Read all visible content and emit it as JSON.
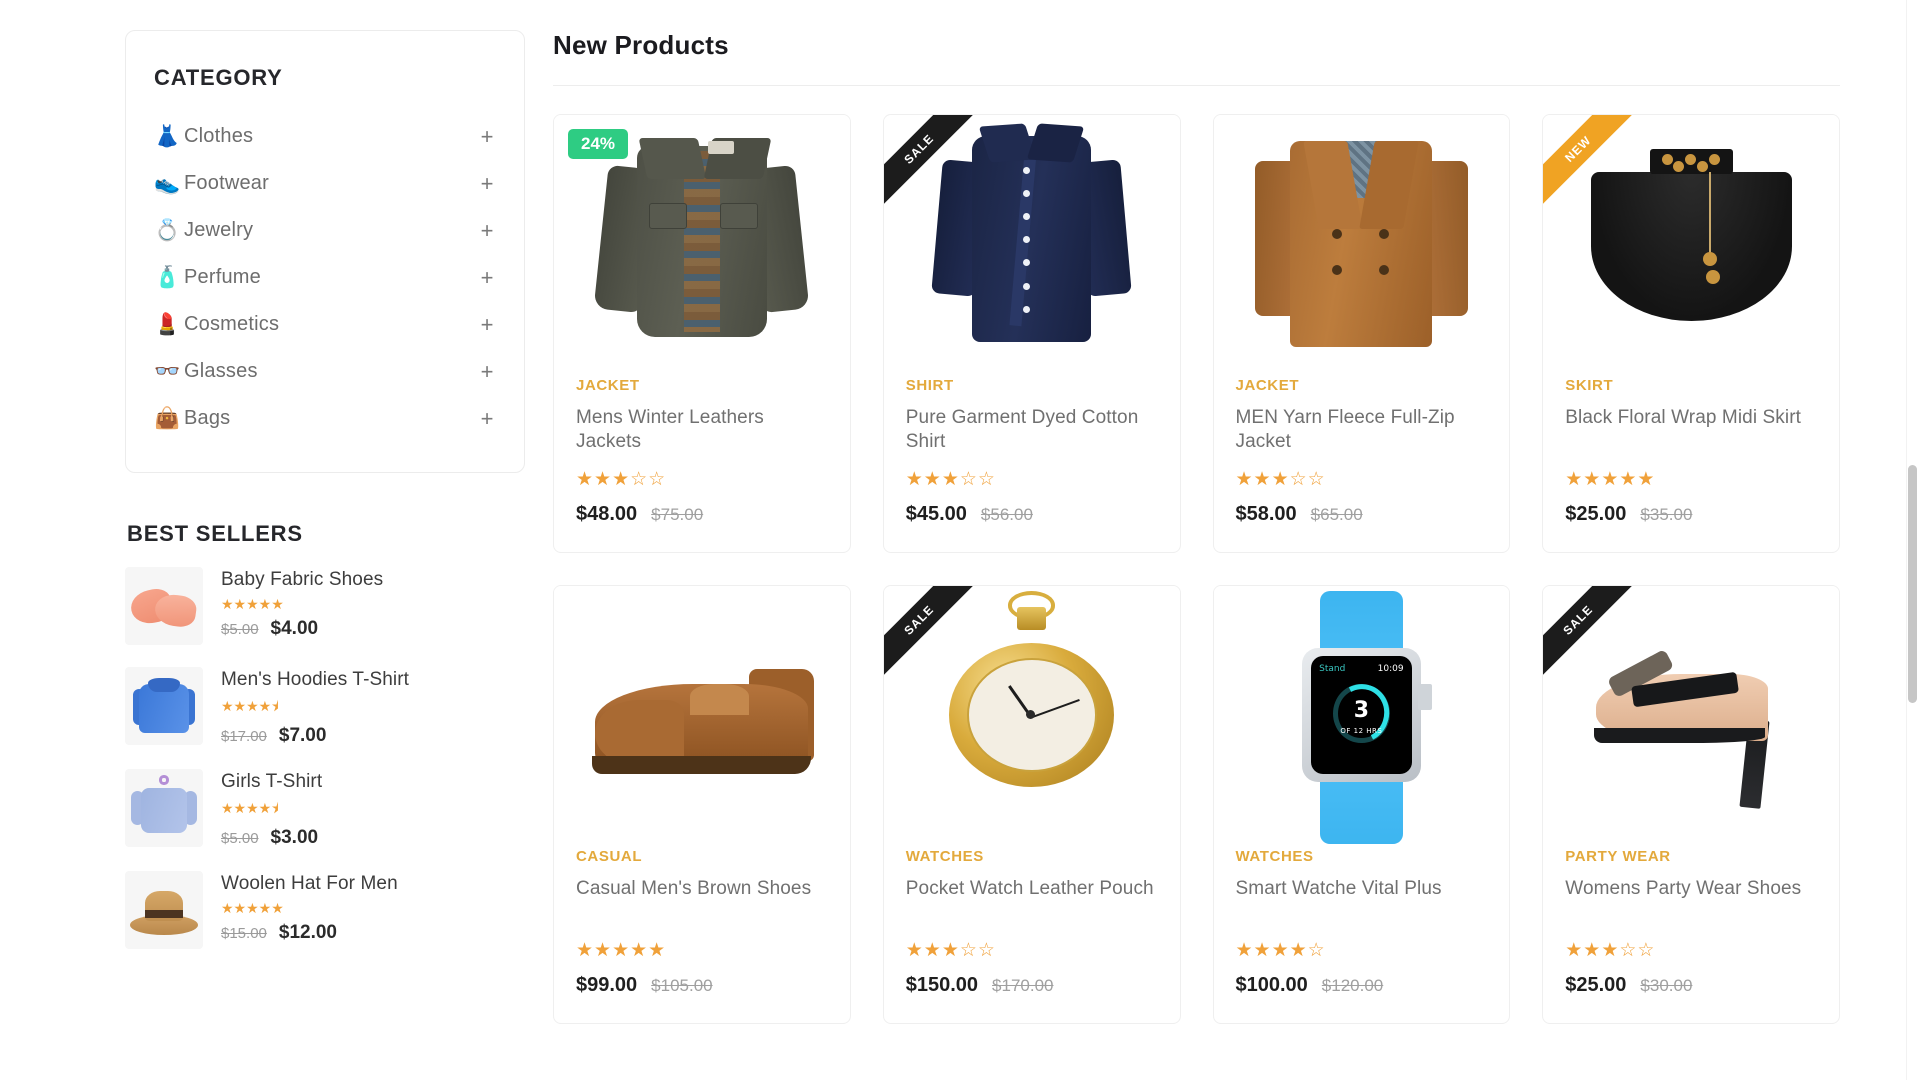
{
  "sidebar": {
    "category": {
      "title": "CATEGORY",
      "expand_symbol": "+",
      "items": [
        {
          "label": "Clothes",
          "icon": "dress-icon",
          "emoji": "👗"
        },
        {
          "label": "Footwear",
          "icon": "sneaker-icon",
          "emoji": "👟"
        },
        {
          "label": "Jewelry",
          "icon": "gem-ring-icon",
          "emoji": "💍"
        },
        {
          "label": "Perfume",
          "icon": "perfume-icon",
          "emoji": "🧴"
        },
        {
          "label": "Cosmetics",
          "icon": "lipstick-icon",
          "emoji": "💄"
        },
        {
          "label": "Glasses",
          "icon": "glasses-icon",
          "emoji": "👓"
        },
        {
          "label": "Bags",
          "icon": "handbag-icon",
          "emoji": "👜"
        }
      ]
    },
    "best_sellers": {
      "title": "BEST SELLERS",
      "items": [
        {
          "name": "Baby Fabric Shoes",
          "rating": 5,
          "price": "$4.00",
          "old_price": "$5.00",
          "art": "baby-shoes"
        },
        {
          "name": "Men's Hoodies T-Shirt",
          "rating": 4.5,
          "price": "$7.00",
          "old_price": "$17.00",
          "art": "hoodie"
        },
        {
          "name": "Girls T-Shirt",
          "rating": 4.5,
          "price": "$3.00",
          "old_price": "$5.00",
          "art": "girls-tshirt"
        },
        {
          "name": "Woolen Hat For Men",
          "rating": 5,
          "price": "$12.00",
          "old_price": "$15.00",
          "art": "hat"
        }
      ]
    }
  },
  "main": {
    "heading": "New Products",
    "products": [
      {
        "category": "JACKET",
        "name": "Mens Winter Leathers Jackets",
        "rating": 3,
        "price": "$48.00",
        "old_price": "$75.00",
        "badge": {
          "type": "discount",
          "text": "24%"
        },
        "art": "jacket"
      },
      {
        "category": "SHIRT",
        "name": "Pure Garment Dyed Cotton Shirt",
        "rating": 3,
        "price": "$45.00",
        "old_price": "$56.00",
        "badge": {
          "type": "ribbon-sale",
          "text": "SALE"
        },
        "art": "navy-shirt"
      },
      {
        "category": "JACKET",
        "name": "MEN Yarn Fleece Full-Zip Jacket",
        "rating": 3,
        "price": "$58.00",
        "old_price": "$65.00",
        "badge": null,
        "art": "camel-coat"
      },
      {
        "category": "SKIRT",
        "name": "Black Floral Wrap Midi Skirt",
        "rating": 5,
        "price": "$25.00",
        "old_price": "$35.00",
        "badge": {
          "type": "ribbon-new",
          "text": "NEW"
        },
        "art": "black-skirt"
      },
      {
        "category": "CASUAL",
        "name": "Casual Men's Brown Shoes",
        "rating": 5,
        "price": "$99.00",
        "old_price": "$105.00",
        "badge": null,
        "art": "brown-shoe"
      },
      {
        "category": "WATCHES",
        "name": "Pocket Watch Leather Pouch",
        "rating": 3,
        "price": "$150.00",
        "old_price": "$170.00",
        "badge": {
          "type": "ribbon-sale",
          "text": "SALE"
        },
        "art": "pocket-watch"
      },
      {
        "category": "WATCHES",
        "name": "Smart Watche Vital Plus",
        "rating": 4,
        "price": "$100.00",
        "old_price": "$120.00",
        "badge": null,
        "art": "smart-watch",
        "screen": {
          "label": "Stand",
          "time": "10:09",
          "value": "3",
          "sub": "OF 12 HRS"
        }
      },
      {
        "category": "PARTY WEAR",
        "name": "Womens Party Wear Shoes",
        "rating": 3,
        "price": "$25.00",
        "old_price": "$30.00",
        "badge": {
          "type": "ribbon-sale",
          "text": "SALE"
        },
        "art": "high-heel"
      }
    ]
  },
  "colors": {
    "accent_category": "#e3a93c",
    "star": "#f0a13a",
    "discount_badge": "#2ecc83",
    "ribbon_sale": "#1c1c1c",
    "ribbon_new": "#f0a323",
    "price": "#1f1f1f",
    "old_price": "#a0a0a0"
  },
  "scrollbar": {
    "present": true
  }
}
